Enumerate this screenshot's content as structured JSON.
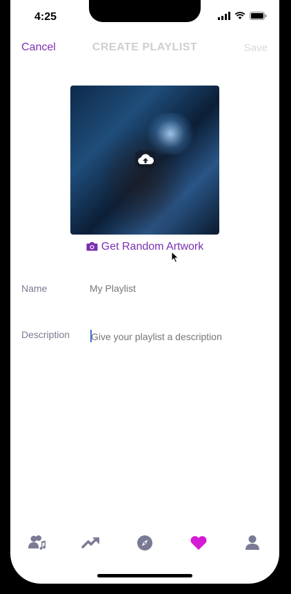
{
  "status": {
    "time": "4:25"
  },
  "nav": {
    "cancel": "Cancel",
    "title": "CREATE PLAYLIST",
    "save": "Save"
  },
  "artwork": {
    "random_label": "Get Random Artwork"
  },
  "form": {
    "name_label": "Name",
    "name_placeholder": "My Playlist",
    "description_label": "Description",
    "description_placeholder": "Give your playlist a description"
  },
  "tabs": [
    {
      "icon": "friends-music-icon"
    },
    {
      "icon": "trending-icon"
    },
    {
      "icon": "compass-icon"
    },
    {
      "icon": "heart-icon",
      "active": true
    },
    {
      "icon": "profile-icon"
    }
  ],
  "colors": {
    "accent": "#7b2fb0",
    "active_tab": "#d41ad4",
    "inactive_tab": "#7a7a95"
  }
}
